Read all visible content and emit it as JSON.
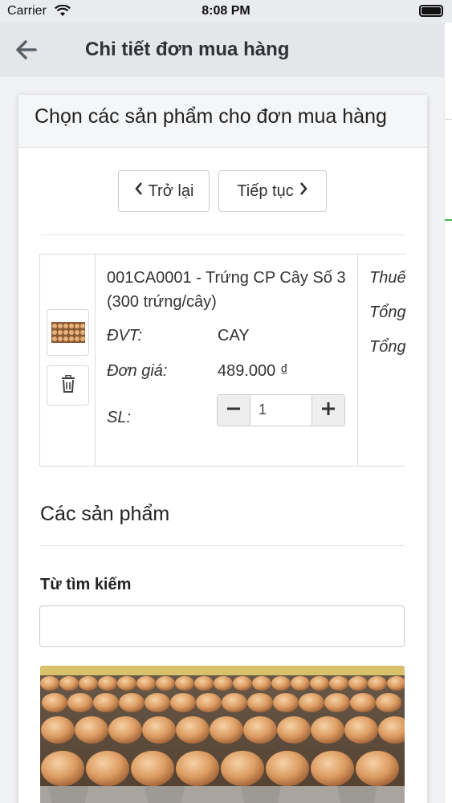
{
  "status_bar": {
    "carrier": "Carrier",
    "time": "8:08 PM"
  },
  "nav": {
    "title": "Chi tiết đơn mua hàng",
    "back_icon": "arrow-left-icon"
  },
  "card": {
    "header": "Chọn các sản phẩm cho đơn mua hàng",
    "back_button": "Trở lại",
    "next_button": "Tiếp tục"
  },
  "product": {
    "name": "001CA0001 - Trứng CP Cây Số 3 (300 trứng/cây)",
    "unit_label": "ĐVT:",
    "unit_value": "CAY",
    "price_label": "Đơn giá:",
    "price_value": "489.000 ₫",
    "qty_label": "SL:",
    "qty_value": "1",
    "tax_label": "Thuế",
    "total_label_1": "Tổng",
    "total_label_2": "Tổng"
  },
  "products_section": {
    "title": "Các sản phẩm",
    "search_label": "Từ tìm kiếm",
    "search_value": ""
  },
  "colors": {
    "nav_bg": "#e4e6e9",
    "accent_green": "#4caf50"
  }
}
